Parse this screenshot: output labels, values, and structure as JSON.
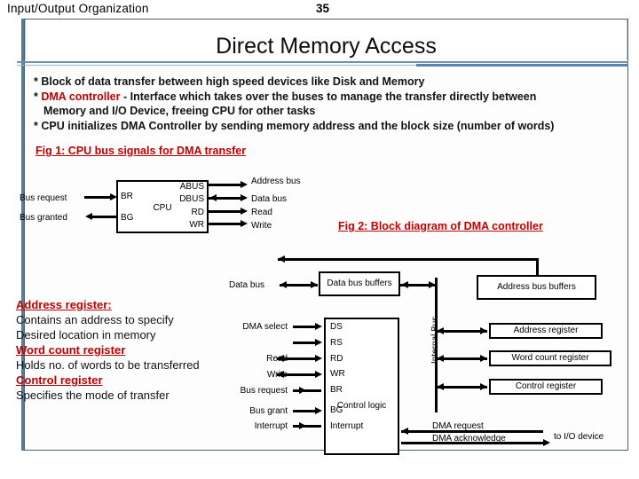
{
  "header": {
    "course_title": "Input/Output Organization",
    "slide_number": "35"
  },
  "title": "Direct Memory Access",
  "bullets": [
    {
      "marker": "*",
      "parts": [
        {
          "text": "Block of data transfer between high speed devices like Disk and Memory",
          "red": false
        }
      ]
    },
    {
      "marker": "*",
      "parts": [
        {
          "text": "DMA controller",
          "red": true
        },
        {
          "text": " - Interface which takes over the buses to manage the transfer directly between",
          "red": false
        }
      ]
    },
    {
      "marker": "",
      "parts": [
        {
          "text": "Memory and I/O Device, freeing CPU for other tasks",
          "red": false
        }
      ]
    },
    {
      "marker": "*",
      "parts": [
        {
          "text": "CPU initializes DMA Controller by sending memory address and the block size (number of words)",
          "red": false
        }
      ]
    }
  ],
  "fig1": {
    "caption": "Fig 1: CPU bus signals for DMA transfer",
    "cpu_label": "CPU",
    "left_labels": [
      "Bus request",
      "Bus granted"
    ],
    "left_pins": [
      "BR",
      "BG"
    ],
    "right_pins": [
      "ABUS",
      "DBUS",
      "RD",
      "WR"
    ],
    "right_labels": [
      "Address bus",
      "Data bus",
      "Read",
      "Write"
    ]
  },
  "fig2": {
    "caption": " Fig 2: Block diagram of DMA controller",
    "data_bus_label": "Data bus",
    "data_bus_buffers": "Data bus buffers",
    "address_bus_buffers": "Address bus buffers",
    "internal_bus_label": "Internal Bus",
    "control_logic": "Control logic",
    "control_left_labels": [
      "DMA select",
      "",
      "Read",
      "Write",
      "Bus request",
      "Bus grant",
      "Interrupt"
    ],
    "control_pins": [
      "DS",
      "RS",
      "RD",
      "WR",
      "BR",
      "BG",
      "Interrupt"
    ],
    "registers": [
      "Address register",
      "Word count register",
      "Control register"
    ],
    "dma_request": "DMA request",
    "dma_acknowledge": "DMA acknowledge",
    "to_io_device": "to I/O device"
  },
  "register_notes": [
    {
      "heading": " Address register:",
      "lines": [
        "Contains an address to specify",
        "Desired location in memory"
      ]
    },
    {
      "heading": "Word count register",
      "lines": [
        "Holds no. of words to be transferred"
      ]
    },
    {
      "heading": "Control register",
      "lines": [
        "Specifies the mode of transfer"
      ]
    }
  ],
  "colors": {
    "accent_red": "#c00000",
    "frame_blue": "#4a6070",
    "rule_blue": "#5b83b1"
  }
}
